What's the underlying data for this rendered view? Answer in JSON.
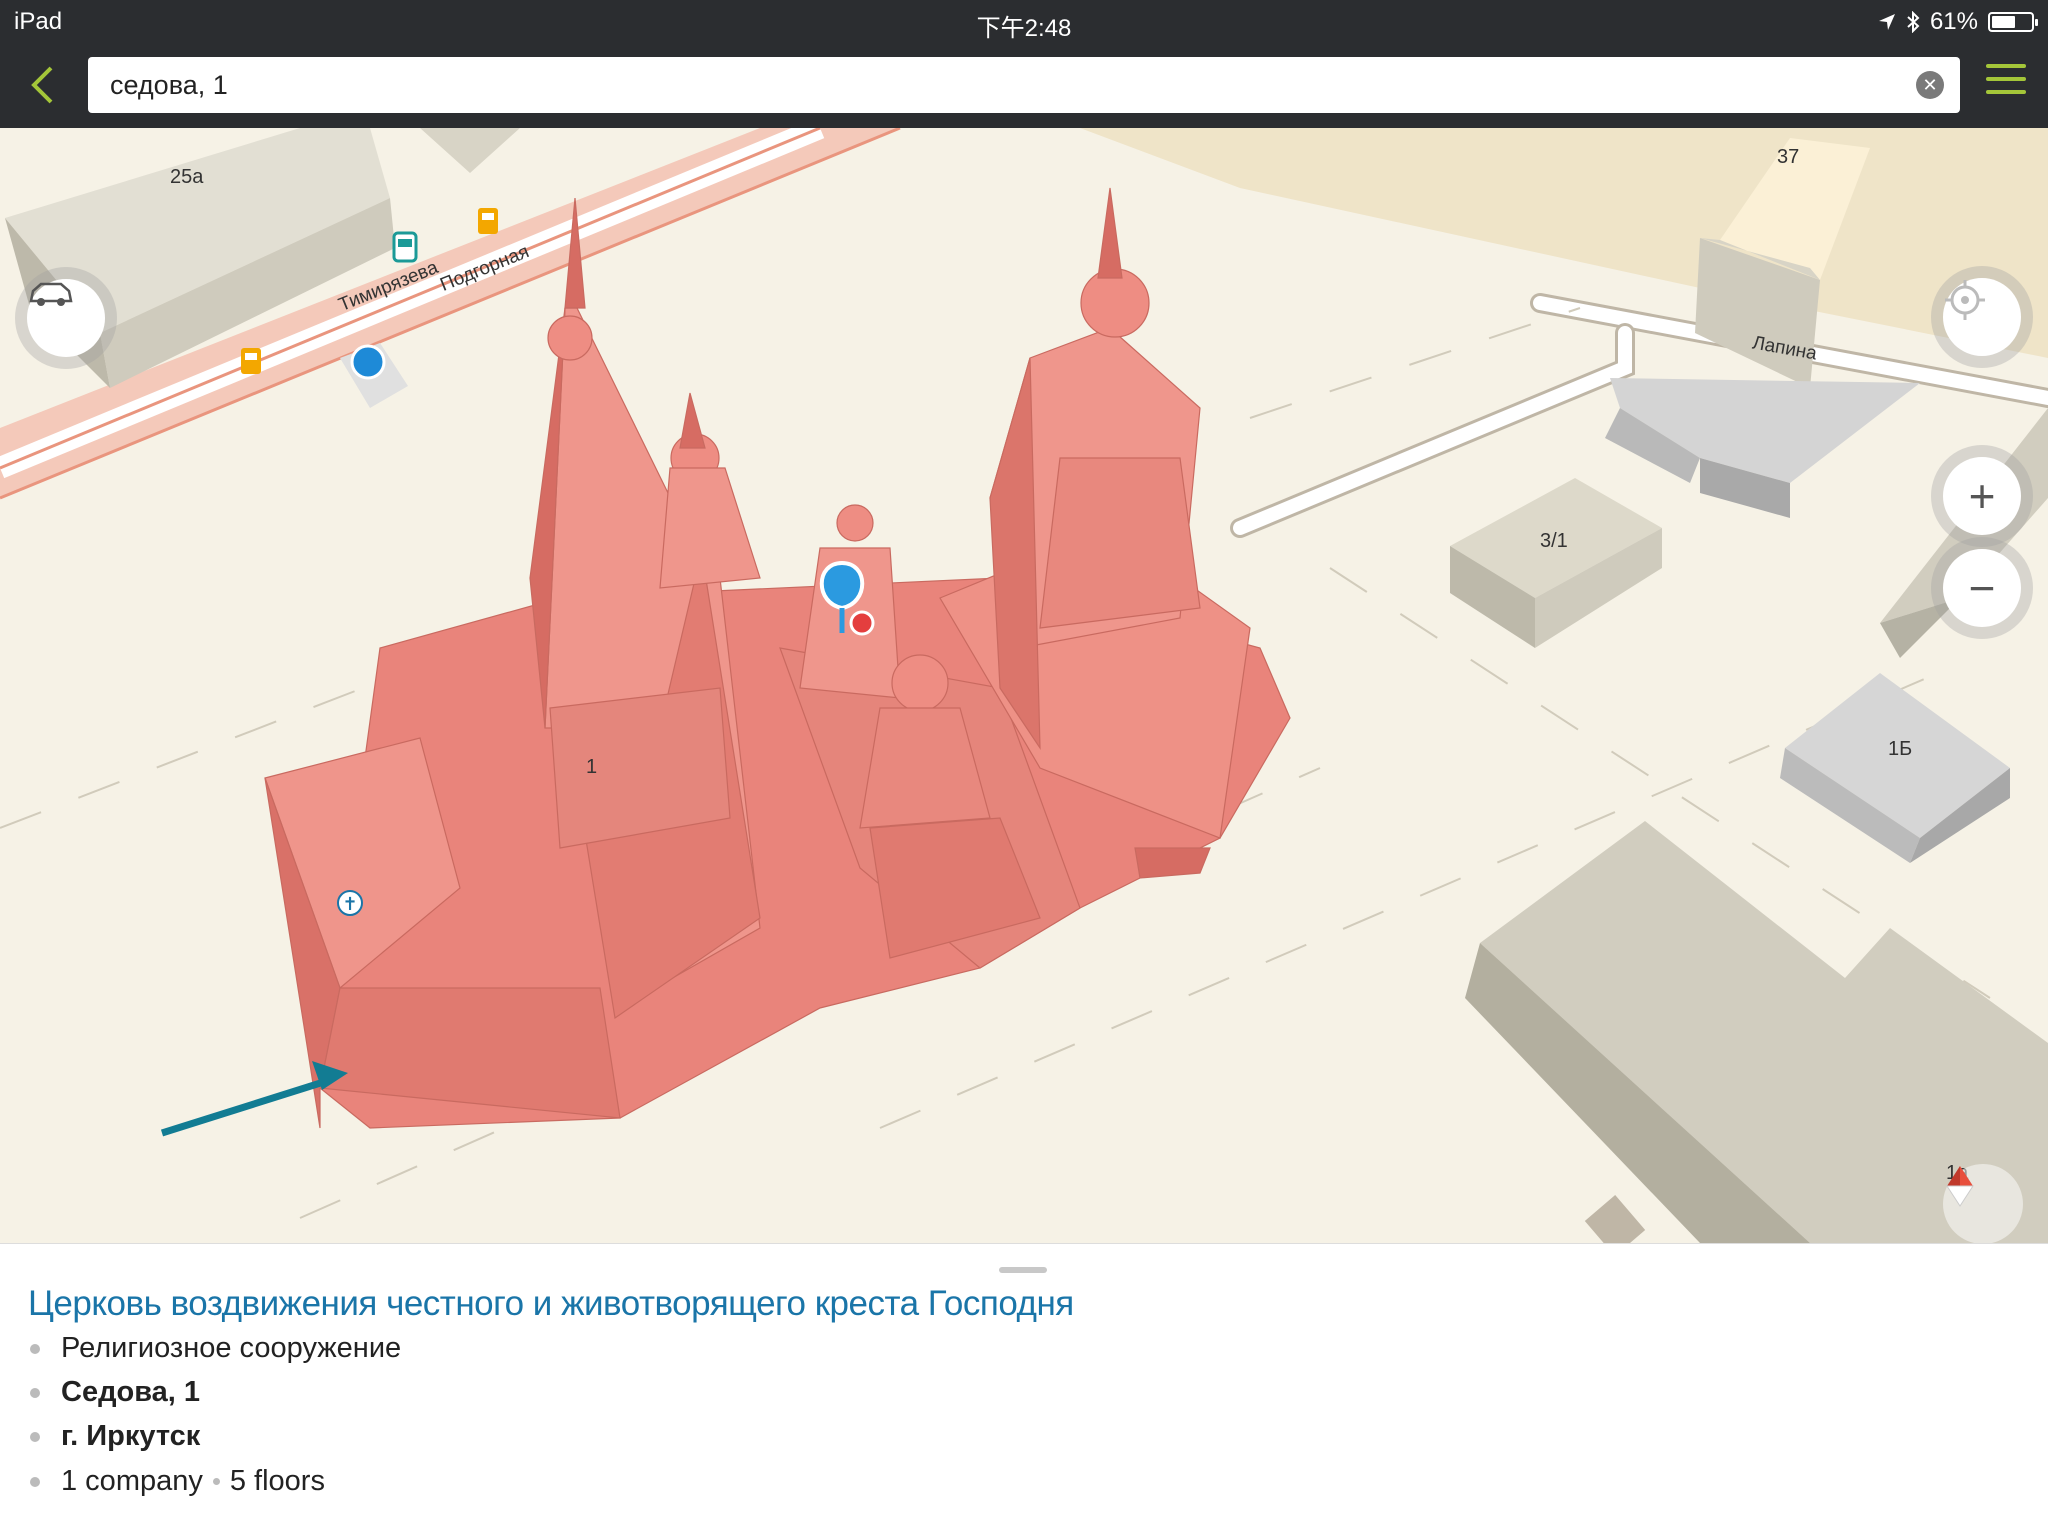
{
  "status_bar": {
    "device": "iPad",
    "time": "下午2:48",
    "battery": "61%",
    "battery_level": 0.61
  },
  "search": {
    "value": "седова, 1",
    "back_icon": "chevron-left-icon",
    "clear_icon": "clear-icon",
    "menu_icon": "hamburger-menu-icon",
    "accent_color": "#a4c639"
  },
  "map": {
    "building_labels": [
      "25а",
      "37",
      "3/1",
      "1Б",
      "1",
      "1а"
    ],
    "street_labels": [
      "Тимирязева",
      "Подгорная",
      "Лапина"
    ],
    "highlight_color": "#ee8a80",
    "controls": {
      "traffic_icon": "traffic-car-icon",
      "locate_icon": "crosshair-icon",
      "zoom_in": "+",
      "zoom_out": "−",
      "compass_icon": "compass-icon"
    }
  },
  "place": {
    "title": "Церковь воздвижения честного и животворящего креста Господня",
    "category": "Религиозное сооружение",
    "address": "Седова, 1",
    "city": "г. Иркутск",
    "companies": "1 company",
    "floors": "5 floors"
  }
}
